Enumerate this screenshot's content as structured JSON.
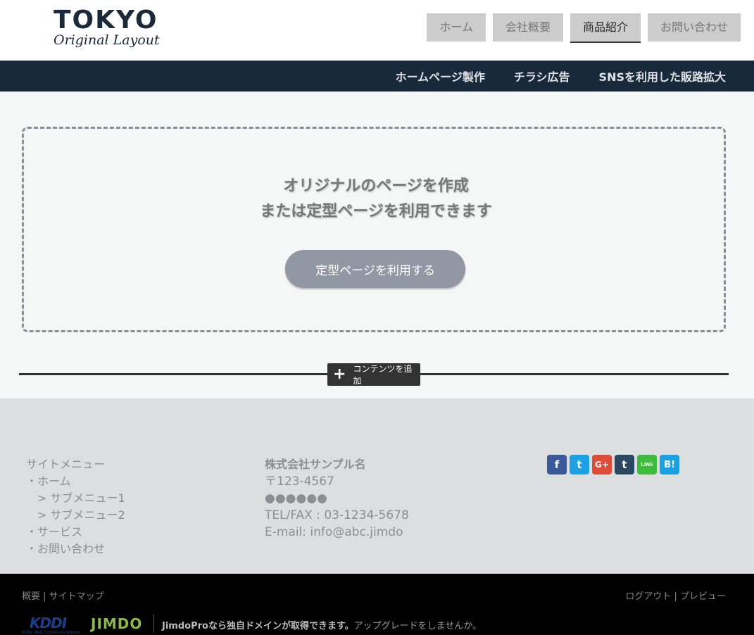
{
  "header": {
    "logo_main": "TOKYO",
    "logo_sub": "Original Layout",
    "nav": [
      {
        "label": "ホーム",
        "active": false
      },
      {
        "label": "会社概要",
        "active": false
      },
      {
        "label": "商品紹介",
        "active": true
      },
      {
        "label": "お問い合わせ",
        "active": false
      }
    ]
  },
  "subnav": {
    "items": [
      "ホームページ製作",
      "チラシ広告",
      "SNSを利用した販路拡大"
    ]
  },
  "content": {
    "message_line1": "オリジナルのページを作成",
    "message_line2": "または定型ページを利用できます",
    "template_button": "定型ページを利用する",
    "add_content": "コンテンツを追加"
  },
  "footer": {
    "menu_title": "サイトメニュー",
    "menu_items": [
      "・ホーム",
      "　> サブメニュー1",
      "　> サブメニュー2",
      " ・サービス",
      " ・お問い合わせ"
    ],
    "company_name": "株式会社サンプル名",
    "postal": "〒123-4567",
    "address": "●●●●●●",
    "telfax": "TEL/FAX : 03-1234-5678",
    "email": "E-mail: info@abc.jimdo",
    "social": [
      {
        "icon": "facebook-icon",
        "glyph": "f",
        "color": "#3b5998"
      },
      {
        "icon": "twitter-icon",
        "glyph": "t",
        "color": "#1da1e2"
      },
      {
        "icon": "google-plus-icon",
        "glyph": "G+",
        "color": "#dd4b39"
      },
      {
        "icon": "tumblr-icon",
        "glyph": "t",
        "color": "#2c4762"
      },
      {
        "icon": "line-icon",
        "glyph": "LINE",
        "color": "#3cbb3c"
      },
      {
        "icon": "hatena-bookmark-icon",
        "glyph": "B!",
        "color": "#1ba0e1"
      }
    ]
  },
  "bottombar": {
    "left_links": [
      "概要",
      "サイトマップ"
    ],
    "right_links": [
      "ログアウト",
      "プレビュー"
    ],
    "kddi_logo": "KDDI",
    "kddi_tagline": "KDDI Web Communications",
    "jimdo_logo": "JIMDO",
    "promo_bold": "JimdoProなら独自ドメインが取得できます。",
    "promo_rest": "アップグレードをしませんか。"
  }
}
